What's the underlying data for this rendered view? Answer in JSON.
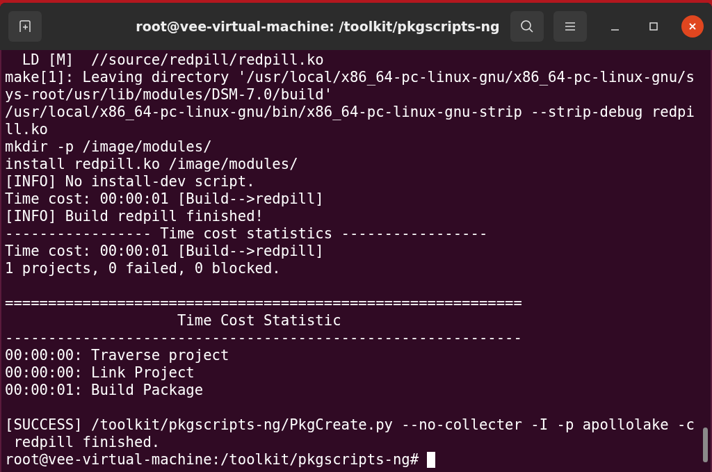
{
  "window": {
    "title": "root@vee-virtual-machine: /toolkit/pkgscripts-ng"
  },
  "terminal": {
    "lines": [
      {
        "kind": "text",
        "text": "  LD [M]  //source/redpill/redpill.ko"
      },
      {
        "kind": "text",
        "text": "make[1]: Leaving directory '/usr/local/x86_64-pc-linux-gnu/x86_64-pc-linux-gnu/s"
      },
      {
        "kind": "text",
        "text": "ys-root/usr/lib/modules/DSM-7.0/build'"
      },
      {
        "kind": "text",
        "text": "/usr/local/x86_64-pc-linux-gnu/bin/x86_64-pc-linux-gnu-strip --strip-debug redpi"
      },
      {
        "kind": "text",
        "text": "ll.ko"
      },
      {
        "kind": "text",
        "text": "mkdir -p /image/modules/"
      },
      {
        "kind": "text",
        "text": "install redpill.ko /image/modules/"
      },
      {
        "kind": "text",
        "text": "[INFO] No install-dev script."
      },
      {
        "kind": "text",
        "text": "Time cost: 00:00:01 [Build-->redpill]"
      },
      {
        "kind": "text",
        "text": "[INFO] Build redpill finished!"
      },
      {
        "kind": "text",
        "text": "----------------- Time cost statistics -----------------"
      },
      {
        "kind": "text",
        "text": "Time cost: 00:00:01 [Build-->redpill]"
      },
      {
        "kind": "text",
        "text": "1 projects, 0 failed, 0 blocked."
      },
      {
        "kind": "blank"
      },
      {
        "kind": "text",
        "text": "============================================================"
      },
      {
        "kind": "text",
        "text": "                    Time Cost Statistic"
      },
      {
        "kind": "text",
        "text": "------------------------------------------------------------"
      },
      {
        "kind": "text",
        "text": "00:00:00: Traverse project"
      },
      {
        "kind": "text",
        "text": "00:00:00: Link Project"
      },
      {
        "kind": "text",
        "text": "00:00:01: Build Package"
      },
      {
        "kind": "blank"
      },
      {
        "kind": "text",
        "text": "[SUCCESS] /toolkit/pkgscripts-ng/PkgCreate.py --no-collecter -I -p apollolake -c"
      },
      {
        "kind": "text",
        "text": " redpill finished."
      },
      {
        "kind": "prompt",
        "text": "root@vee-virtual-machine:/toolkit/pkgscripts-ng#"
      }
    ]
  }
}
